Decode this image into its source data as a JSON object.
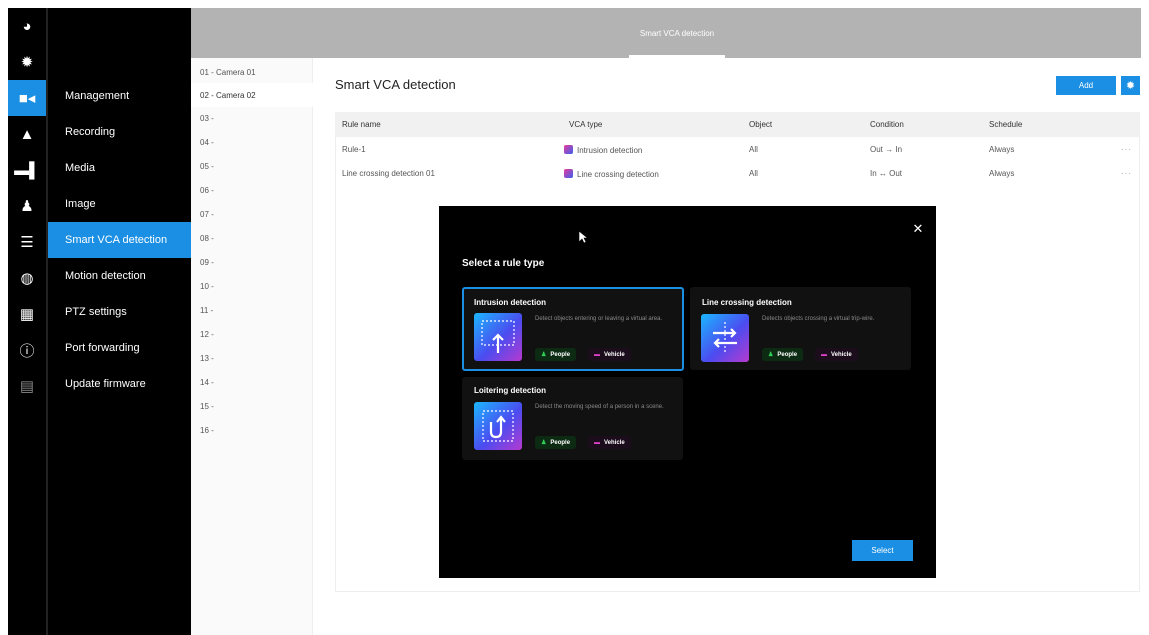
{
  "topbar": {
    "tab_label": "Smart VCA detection"
  },
  "rail_icons": [
    "eye-icon",
    "gear-icon",
    "camera-icon",
    "bell-icon",
    "monitor-icon",
    "user-icon",
    "database-icon",
    "globe-icon",
    "grid-icon",
    "info-icon",
    "network-icon"
  ],
  "nav": {
    "items": [
      {
        "label": "Management"
      },
      {
        "label": "Recording"
      },
      {
        "label": "Media"
      },
      {
        "label": "Image"
      },
      {
        "label": "Smart VCA detection"
      },
      {
        "label": "Motion detection"
      },
      {
        "label": "PTZ settings"
      },
      {
        "label": "Port forwarding"
      },
      {
        "label": "Update firmware"
      }
    ],
    "active_index": 4
  },
  "cameras": {
    "items": [
      "01 - Camera 01",
      "02 - Camera 02",
      "03 -",
      "04 -",
      "05 -",
      "06 -",
      "07 -",
      "08 -",
      "09 -",
      "10 -",
      "11 -",
      "12 -",
      "13 -",
      "14 -",
      "15 -",
      "16 -"
    ],
    "selected_index": 1
  },
  "main": {
    "title": "Smart VCA detection",
    "add_label": "Add",
    "table": {
      "headers": [
        "Rule name",
        "VCA type",
        "Object",
        "Condition",
        "Schedule"
      ],
      "rows": [
        {
          "rule": "Rule-1",
          "vca": "Intrusion detection",
          "object": "All",
          "condition": "Out → In",
          "schedule": "Always",
          "more": "···"
        },
        {
          "rule": "Line crossing detection 01",
          "vca": "Line crossing detection",
          "object": "All",
          "condition": "In ↔ Out",
          "schedule": "Always",
          "more": "···"
        }
      ]
    }
  },
  "modal": {
    "title": "Select a rule type",
    "close": "✕",
    "select_label": "Select",
    "cards": [
      {
        "title": "Intrusion detection",
        "desc": "Detect objects entering or leaving a virtual area.",
        "people": "People",
        "vehicle": "Vehicle",
        "selected": true
      },
      {
        "title": "Line crossing detection",
        "desc": "Detects objects crossing a virtual trip-wire.",
        "people": "People",
        "vehicle": "Vehicle",
        "selected": false
      },
      {
        "title": "Loitering detection",
        "desc": "Detect the moving speed of a person in a scene.",
        "people": "People",
        "vehicle": "Vehicle",
        "selected": false
      }
    ]
  },
  "colors": {
    "accent": "#1a8fe3",
    "sidebar": "#000000",
    "topbar": "#b3b3b3"
  }
}
